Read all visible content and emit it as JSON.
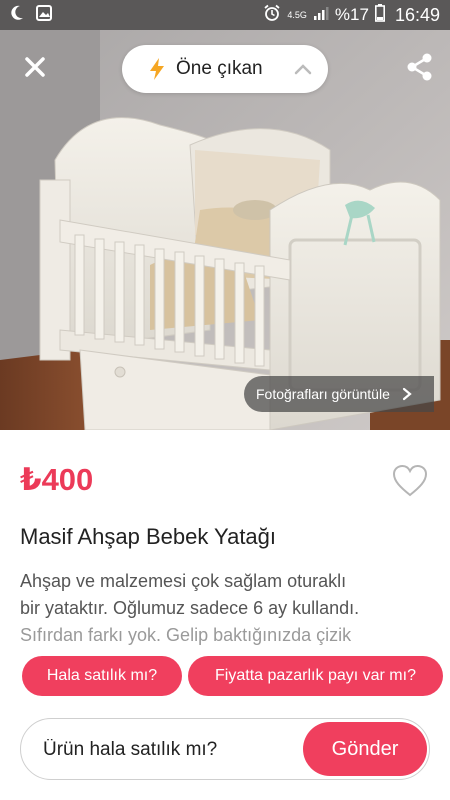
{
  "status_bar": {
    "network": "4.5G",
    "battery": "%17",
    "time": "16:49"
  },
  "header": {
    "featured_label": "Öne çıkan",
    "icons": {
      "close": "close-icon",
      "share": "share-icon",
      "bolt": "lightning-bolt-icon",
      "collapse": "chevron-up-icon"
    }
  },
  "photo": {
    "view_photos_label": "Fotoğrafları görüntüle",
    "subject": "white wooden baby crib"
  },
  "listing": {
    "price": "₺400",
    "title": "Masif Ahşap Bebek Yatağı",
    "description_lines": [
      "Ahşap ve malzemesi çok sağlam oturaklı",
      "bir yataktır. Oğlumuz sadece 6 ay kullandı.",
      "Sıfırdan farkı yok. Gelip baktığınızda çizik"
    ],
    "favorite_icon": "heart-outline-icon"
  },
  "quick_questions": [
    {
      "label": "Hala satılık mı?"
    },
    {
      "label": "Fiyatta pazarlık payı var mı?"
    }
  ],
  "message": {
    "value": "Ürün hala satılık mı?",
    "send_label": "Gönder"
  },
  "colors": {
    "accent": "#f03f5e",
    "price": "#ec3a58",
    "status_bar": "#5a5858"
  }
}
